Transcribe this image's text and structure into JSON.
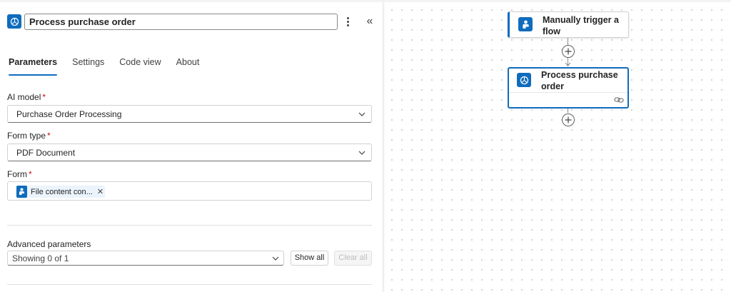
{
  "panel": {
    "title": "Process purchase order",
    "tabs": [
      {
        "label": "Parameters",
        "active": true
      },
      {
        "label": "Settings",
        "active": false
      },
      {
        "label": "Code view",
        "active": false
      },
      {
        "label": "About",
        "active": false
      }
    ],
    "fields": {
      "ai_model": {
        "label": "AI model",
        "required_mark": "*",
        "value": "Purchase Order Processing"
      },
      "form_type": {
        "label": "Form type",
        "required_mark": "*",
        "value": "PDF Document"
      },
      "form": {
        "label": "Form",
        "required_mark": "*",
        "token_label": "File content con...",
        "token_remove": "✕"
      }
    },
    "advanced": {
      "label": "Advanced parameters",
      "value": "Showing 0 of 1",
      "show_all": "Show all",
      "clear_all": "Clear all"
    },
    "collapse_glyph": "«"
  },
  "canvas": {
    "nodes": [
      {
        "title": "Manually trigger a flow",
        "icon": "person-trigger-icon"
      },
      {
        "title": "Process purchase order",
        "icon": "ai-builder-icon",
        "selected": true
      }
    ]
  },
  "colors": {
    "accent": "#0f6cbd",
    "required": "#c50f1f"
  }
}
